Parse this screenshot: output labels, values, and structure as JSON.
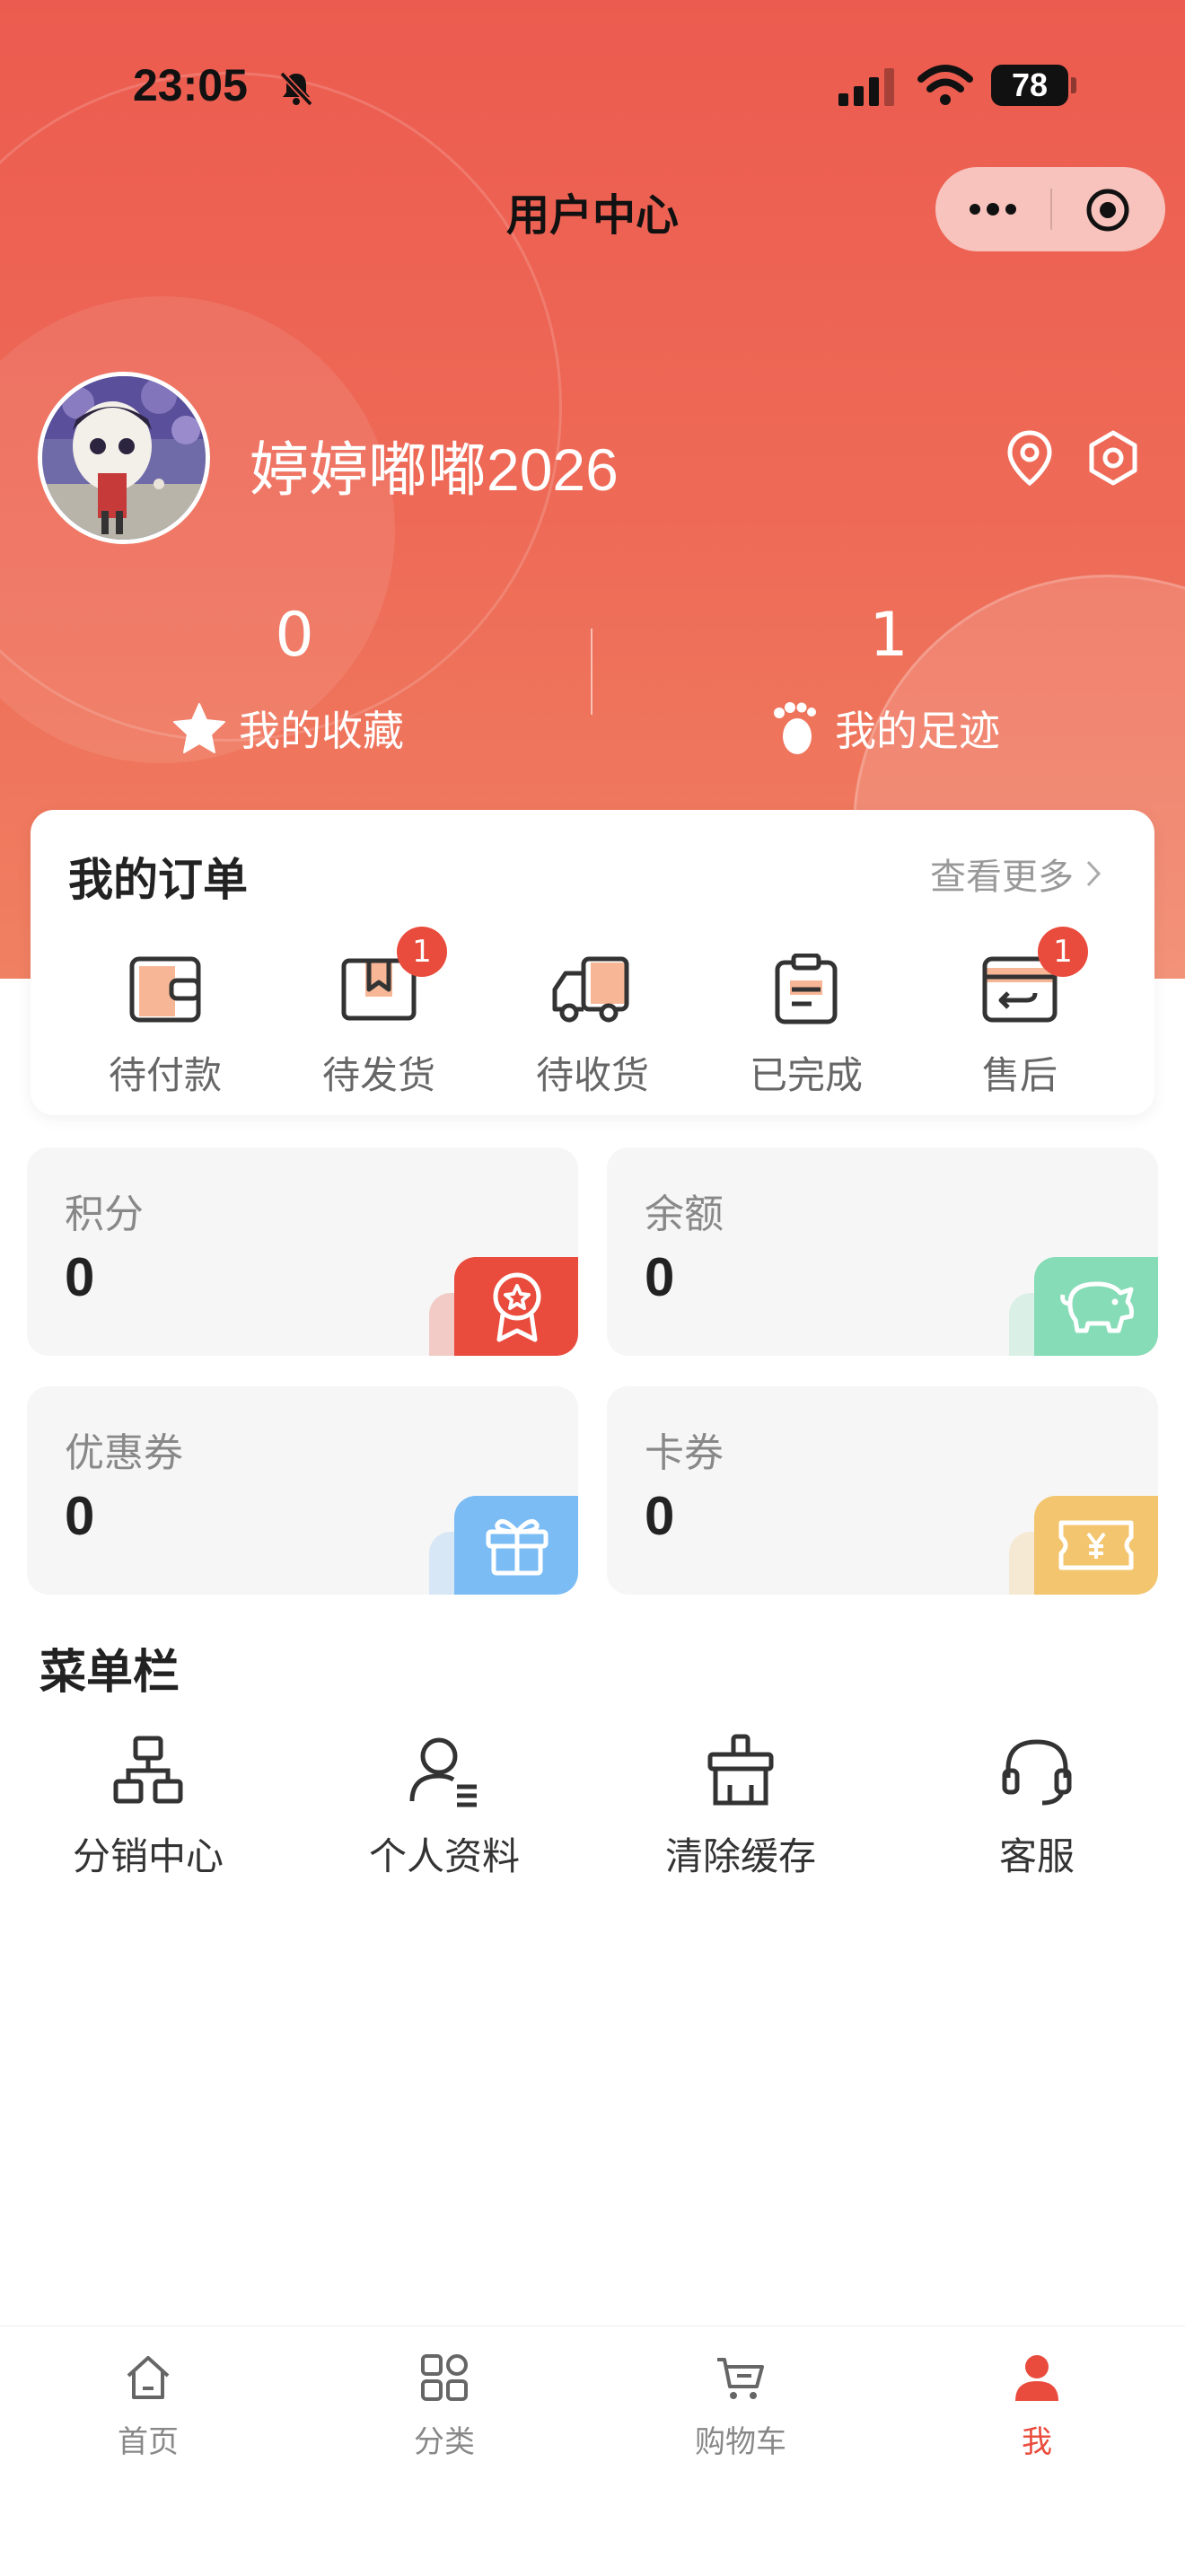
{
  "status_bar": {
    "time": "23:05",
    "battery": "78"
  },
  "nav": {
    "title": "用户中心"
  },
  "user": {
    "name": "婷婷嘟嘟2026"
  },
  "stats": [
    {
      "value": "0",
      "label": "我的收藏",
      "icon": "star-icon"
    },
    {
      "value": "1",
      "label": "我的足迹",
      "icon": "footprint-icon"
    }
  ],
  "orders": {
    "title": "我的订单",
    "more": "查看更多",
    "items": [
      {
        "label": "待付款",
        "icon": "wallet-icon",
        "badge": ""
      },
      {
        "label": "待发货",
        "icon": "box-icon",
        "badge": "1"
      },
      {
        "label": "待收货",
        "icon": "truck-icon",
        "badge": ""
      },
      {
        "label": "已完成",
        "icon": "clipboard-icon",
        "badge": ""
      },
      {
        "label": "售后",
        "icon": "return-icon",
        "badge": "1"
      }
    ]
  },
  "assets": [
    {
      "label": "积分",
      "value": "0",
      "icon": "medal-icon",
      "color": "#e94b3c"
    },
    {
      "label": "余额",
      "value": "0",
      "icon": "piggy-bank-icon",
      "color": "#86dcb7"
    },
    {
      "label": "优惠券",
      "value": "0",
      "icon": "gift-icon",
      "color": "#7bbcf5"
    },
    {
      "label": "卡券",
      "value": "0",
      "icon": "ticket-icon",
      "color": "#f3c56e"
    }
  ],
  "menu": {
    "title": "菜单栏",
    "items": [
      {
        "label": "分销中心",
        "icon": "org-chart-icon"
      },
      {
        "label": "个人资料",
        "icon": "user-profile-icon"
      },
      {
        "label": "清除缓存",
        "icon": "broom-icon"
      },
      {
        "label": "客服",
        "icon": "headset-icon"
      }
    ]
  },
  "tabbar": {
    "items": [
      {
        "label": "首页",
        "icon": "home-icon",
        "active": false
      },
      {
        "label": "分类",
        "icon": "category-icon",
        "active": false
      },
      {
        "label": "购物车",
        "icon": "cart-icon",
        "active": false
      },
      {
        "label": "我",
        "icon": "person-icon",
        "active": true
      }
    ],
    "active_color": "#e94b3c"
  }
}
